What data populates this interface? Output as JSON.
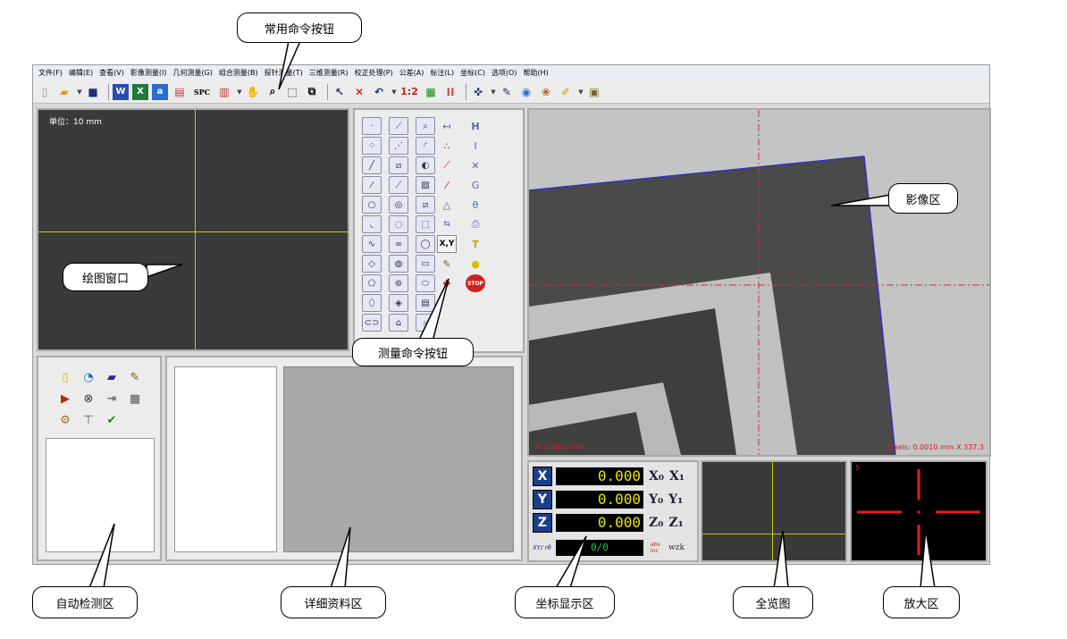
{
  "menu": [
    "文件(F)",
    "编辑(E)",
    "查看(V)",
    "影像测量(I)",
    "几何测量(G)",
    "组合测量(B)",
    "探针测量(T)",
    "三维测量(R)",
    "校正处理(P)",
    "公差(A)",
    "标注(L)",
    "坐标(C)",
    "选项(O)",
    "帮助(H)"
  ],
  "draw_window": {
    "unit_label": "单位：10 mm"
  },
  "coords": {
    "rows": [
      {
        "axis": "X",
        "value": "0.000",
        "lab1": "X₀",
        "lab2": "X₁"
      },
      {
        "axis": "Y",
        "value": "0.000",
        "lab1": "Y₀",
        "lab2": "Y₁"
      },
      {
        "axis": "Z",
        "value": "0.000",
        "lab1": "Z₀",
        "lab2": "Z₁"
      }
    ],
    "footer_left": "XY/ rθ",
    "footer_counter": "0/0",
    "footer_mid": "abs inc",
    "footer_right": "wzk"
  },
  "video": {
    "status_left": "X: 0.0010 mm",
    "status_right": "Pixels: 0.0010 mm   X 337.3",
    "marker": "5"
  },
  "zoom": {
    "marker": "5"
  },
  "toolbar": {
    "spc_label": "SPC",
    "ratio_label": "1:2"
  },
  "buttons": {
    "xy_label": "X,Y",
    "stop_label": "STOP"
  },
  "callouts": {
    "common_cmd": "常用命令按钮",
    "draw_window": "绘图窗口",
    "measure_cmd": "测量命令按钮",
    "video_area": "影像区",
    "auto_detect": "自动检测区",
    "detail_area": "详细资料区",
    "coord_display": "坐标显示区",
    "overview": "全览图",
    "zoom_area": "放大区"
  },
  "colors": {
    "accent": "#1a3f8a",
    "crosshair": "#c8c800",
    "video_cross": "#d03030",
    "readout": "#e8e800"
  }
}
